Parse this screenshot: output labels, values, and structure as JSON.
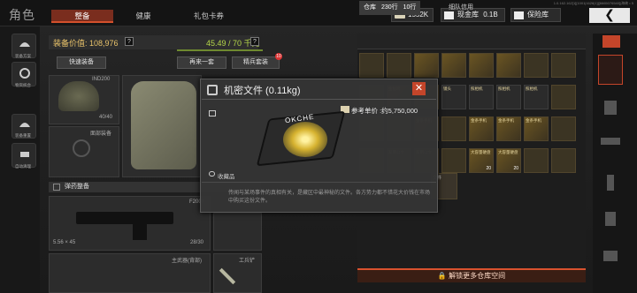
{
  "header": {
    "title": "角色",
    "tabs": [
      "整备",
      "健康",
      "礼包卡券"
    ],
    "version": "1.0.162.162[1][1001|1626|1]|[6665076540]|海峡 • 5",
    "currency": {
      "cash": "1552K",
      "vault_label": "现金库",
      "vault_value": "0.1B",
      "safe_label": "保险库"
    },
    "back": "❮"
  },
  "left_rail": [
    "装备方案",
    "物资统合",
    "装备重置",
    "自动清理"
  ],
  "equip": {
    "value_label": "装备价值: 108,976",
    "help": "?",
    "weight": "45.49 / 70 千克",
    "quick_btn": "快速装备",
    "again_btn": "再来一套",
    "premium_btn": "精兵套装",
    "premium_badge": "10",
    "helmet_name": "IND200",
    "helmet_dur": "40/40",
    "face_label": "面部装备",
    "ammo_section": "弹药整备",
    "rifle_name": "F2000",
    "ammo_type": "5.56 × 45",
    "ammo_count": "28/30",
    "backpack_label": "主武器(背部)",
    "tool_label": "工兵铲"
  },
  "warehouse": {
    "tab_store": "仓库",
    "rows": "230行",
    "rows2": "10行",
    "tab_buy": "细队信用",
    "unlock": "解锁更多仓库空间",
    "cells": [
      {
        "l": "",
        "c": ""
      },
      {
        "l": "",
        "c": ""
      },
      {
        "l": "",
        "c": ""
      },
      {
        "l": "",
        "c": ""
      },
      {
        "l": "",
        "c": ""
      },
      {
        "l": "",
        "c": ""
      },
      {
        "l": "",
        "c": ""
      },
      {
        "l": "",
        "c": ""
      },
      {
        "l": "",
        "c": ""
      },
      {
        "l": "金枪鸣",
        "c": ""
      },
      {
        "l": "金枪鸣",
        "c": ""
      },
      {
        "l": "镜头",
        "c": ""
      },
      {
        "l": "照相机",
        "c": ""
      },
      {
        "l": "照相机",
        "c": ""
      },
      {
        "l": "照相机",
        "c": ""
      },
      {
        "l": "",
        "c": ""
      },
      {
        "l": "",
        "c": ""
      },
      {
        "l": "",
        "c": ""
      },
      {
        "l": "金条手机",
        "c": ""
      },
      {
        "l": "",
        "c": ""
      },
      {
        "l": "金条手机",
        "c": ""
      },
      {
        "l": "金条手机",
        "c": ""
      },
      {
        "l": "金条手机",
        "c": ""
      },
      {
        "l": "",
        "c": ""
      },
      {
        "l": "",
        "c": ""
      },
      {
        "l": "军用公文",
        "c": ""
      },
      {
        "l": "军用公文",
        "c": ""
      },
      {
        "l": "",
        "c": ""
      },
      {
        "l": "大容量硬盘",
        "c": "20"
      },
      {
        "l": "大容量硬盘",
        "c": "20"
      },
      {
        "l": "",
        "c": ""
      },
      {
        "l": "",
        "c": ""
      }
    ],
    "misc": "文件"
  },
  "dialog": {
    "title": "机密文件 (0.11kg)",
    "close": "✕",
    "price": "参考单价 :约5,750,000",
    "category": "收藏品",
    "desc": "传闻与某场事件的真相有关，是藏区中最神秘的文件。各方势力都不惜花大价钱在市场中购买这份文件。",
    "disk_label": "OKCHE"
  }
}
